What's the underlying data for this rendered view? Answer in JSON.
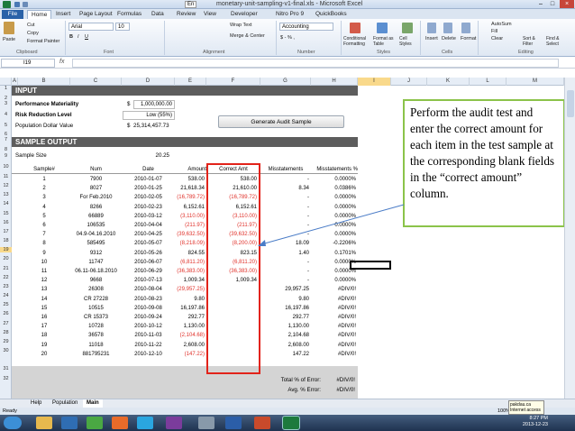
{
  "window": {
    "title": "monetary-unit-sampling-v1-final.xls - Microsoft Excel",
    "name_box_value": "En"
  },
  "ribbon": {
    "tabs": [
      "File",
      "Home",
      "Insert",
      "Page Layout",
      "Formulas",
      "Data",
      "Review",
      "View",
      "Developer",
      "Nitro Pro 9",
      "QuickBooks"
    ],
    "clipboard": {
      "paste": "Paste",
      "cut": "Cut",
      "copy": "Copy",
      "format_painter": "Format Painter",
      "group": "Clipboard"
    },
    "font": {
      "name": "Arial",
      "size": "10",
      "group": "Font"
    },
    "alignment": {
      "wrap": "Wrap Text",
      "merge": "Merge & Center",
      "group": "Alignment"
    },
    "number": {
      "format": "Accounting",
      "group": "Number"
    },
    "styles": {
      "conditional": "Conditional Formatting",
      "format_table": "Format as Table",
      "cell_styles": "Cell Styles",
      "group": "Styles"
    },
    "cells": {
      "insert": "Insert",
      "delete": "Delete",
      "format": "Format",
      "group": "Cells"
    },
    "editing": {
      "autosum": "AutoSum",
      "fill": "Fill",
      "clear": "Clear",
      "sort": "Sort & Filter",
      "find": "Find & Select",
      "group": "Editing"
    }
  },
  "formula_bar": {
    "cell_ref": "I19",
    "fx": "fx",
    "content": ""
  },
  "columns": [
    "A",
    "B",
    "C",
    "D",
    "E",
    "F",
    "G",
    "H",
    "I",
    "J",
    "K",
    "L",
    "M"
  ],
  "rows": [
    1,
    2,
    3,
    4,
    5,
    6,
    7,
    8,
    9,
    10,
    11,
    12,
    13,
    14,
    15,
    16,
    17,
    18,
    19,
    20,
    21,
    22,
    23,
    24,
    25,
    26,
    27,
    28,
    29,
    30,
    31,
    32
  ],
  "input": {
    "heading": "INPUT",
    "materiality_label": "Performance Materiality",
    "materiality_currency": "$",
    "materiality_value": "1,000,000.00",
    "risk_label": "Risk Reduction Level",
    "risk_value": "Low (55%)",
    "population_label": "Population Dollar Value",
    "population_currency": "$",
    "population_value": "25,314,457.73",
    "generate_button": "Generate Audit Sample"
  },
  "sample_output": {
    "heading": "SAMPLE OUTPUT",
    "sample_size_label": "Sample Size",
    "sample_size_value": "20.25",
    "headers": [
      "Sample#",
      "Num",
      "Date",
      "Amount",
      "Correct Amt",
      "Misstatements",
      "Misstatements %"
    ],
    "rows": [
      {
        "n": "1",
        "num": "7900",
        "date": "2010-01-07",
        "amt": "538.00",
        "amt_red": false,
        "corr": "538.00",
        "corr_red": false,
        "mis": "-",
        "pct": "0.0000%"
      },
      {
        "n": "2",
        "num": "8027",
        "date": "2010-01-25",
        "amt": "21,618.34",
        "amt_red": false,
        "corr": "21,610.00",
        "corr_red": false,
        "mis": "8.34",
        "pct": "0.0386%"
      },
      {
        "n": "3",
        "num": "For Feb.2010",
        "date": "2010-02-05",
        "amt": "(16,789.72)",
        "amt_red": true,
        "corr": "(16,789.72)",
        "corr_red": true,
        "mis": "-",
        "pct": "0.0000%"
      },
      {
        "n": "4",
        "num": "8266",
        "date": "2010-02-23",
        "amt": "6,152.61",
        "amt_red": false,
        "corr": "6,152.61",
        "corr_red": false,
        "mis": "-",
        "pct": "0.0000%"
      },
      {
        "n": "5",
        "num": "66889",
        "date": "2010-03-12",
        "amt": "(3,110.00)",
        "amt_red": true,
        "corr": "(3,110.00)",
        "corr_red": true,
        "mis": "-",
        "pct": "0.0000%"
      },
      {
        "n": "6",
        "num": "106535",
        "date": "2010-04-04",
        "amt": "(211.97)",
        "amt_red": true,
        "corr": "(211.97)",
        "corr_red": true,
        "mis": "-",
        "pct": "0.0000%"
      },
      {
        "n": "7",
        "num": "04.9-04.16.2010",
        "date": "2010-04-25",
        "amt": "(39,632.50)",
        "amt_red": true,
        "corr": "(39,632.50)",
        "corr_red": true,
        "mis": "-",
        "pct": "0.0000%"
      },
      {
        "n": "8",
        "num": "585495",
        "date": "2010-05-07",
        "amt": "(8,218.09)",
        "amt_red": true,
        "corr": "(8,200.00)",
        "corr_red": true,
        "mis": "18.09",
        "pct": "-0.2206%"
      },
      {
        "n": "9",
        "num": "9312",
        "date": "2010-05-26",
        "amt": "824.55",
        "amt_red": false,
        "corr": "823.15",
        "corr_red": false,
        "mis": "1.40",
        "pct": "0.1701%"
      },
      {
        "n": "10",
        "num": "11747",
        "date": "2010-06-07",
        "amt": "(6,811.20)",
        "amt_red": true,
        "corr": "(6,811.20)",
        "corr_red": true,
        "mis": "-",
        "pct": "0.0000%"
      },
      {
        "n": "11",
        "num": "06.11-06.18.2010",
        "date": "2010-06-29",
        "amt": "(36,383.00)",
        "amt_red": true,
        "corr": "(36,383.00)",
        "corr_red": true,
        "mis": "-",
        "pct": "0.0000%"
      },
      {
        "n": "12",
        "num": "9668",
        "date": "2010-07-13",
        "amt": "1,009.34",
        "amt_red": false,
        "corr": "1,009.34",
        "corr_red": false,
        "mis": "-",
        "pct": "0.0000%"
      },
      {
        "n": "13",
        "num": "26308",
        "date": "2010-08-04",
        "amt": "(29,957.25)",
        "amt_red": true,
        "corr": "",
        "corr_red": false,
        "mis": "29,957.25",
        "pct": "#DIV/0!"
      },
      {
        "n": "14",
        "num": "CR 27228",
        "date": "2010-08-23",
        "amt": "9.80",
        "amt_red": false,
        "corr": "",
        "corr_red": false,
        "mis": "9.80",
        "pct": "#DIV/0!"
      },
      {
        "n": "15",
        "num": "10515",
        "date": "2010-09-08",
        "amt": "16,197.86",
        "amt_red": false,
        "corr": "",
        "corr_red": false,
        "mis": "16,197.86",
        "pct": "#DIV/0!"
      },
      {
        "n": "16",
        "num": "CR 15373",
        "date": "2010-09-24",
        "amt": "292.77",
        "amt_red": false,
        "corr": "",
        "corr_red": false,
        "mis": "292.77",
        "pct": "#DIV/0!"
      },
      {
        "n": "17",
        "num": "10728",
        "date": "2010-10-12",
        "amt": "1,130.00",
        "amt_red": false,
        "corr": "",
        "corr_red": false,
        "mis": "1,130.00",
        "pct": "#DIV/0!"
      },
      {
        "n": "18",
        "num": "36578",
        "date": "2010-11-03",
        "amt": "(2,104.68)",
        "amt_red": true,
        "corr": "",
        "corr_red": false,
        "mis": "2,104.68",
        "pct": "#DIV/0!"
      },
      {
        "n": "19",
        "num": "11018",
        "date": "2010-11-22",
        "amt": "2,608.00",
        "amt_red": false,
        "corr": "",
        "corr_red": false,
        "mis": "2,608.00",
        "pct": "#DIV/0!"
      },
      {
        "n": "20",
        "num": "881795231",
        "date": "2010-12-10",
        "amt": "(147.22)",
        "amt_red": true,
        "corr": "",
        "corr_red": false,
        "mis": "147.22",
        "pct": "#DIV/0!"
      }
    ],
    "total_label": "Total % of Error:",
    "total_value": "#DIV/0!",
    "avg_label": "Avg. % Error:",
    "avg_value": "#DIV/0!"
  },
  "callout": "Perform the audit test and enter the correct amount for each item in the test sample at the corresponding blank fields in the “correct amount” column.",
  "sheet_tabs": [
    "Help",
    "Population",
    "Main"
  ],
  "active_sheet": "Main",
  "status": {
    "ready": "Ready",
    "zoom": "100%"
  },
  "tooltip": {
    "line1": "pakdau.ca",
    "line2": "Internet access"
  },
  "clock": {
    "time": "8:27 PM",
    "date": "2013-12-23"
  }
}
